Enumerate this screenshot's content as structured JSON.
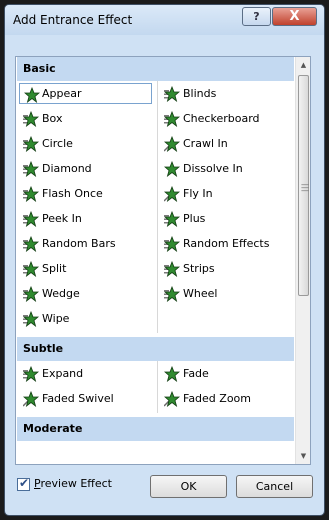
{
  "window": {
    "title": "Add Entrance Effect",
    "help_glyph": "?",
    "close_glyph": "X"
  },
  "sections": [
    {
      "label": "Basic",
      "items": [
        {
          "label": "Appear",
          "icon": "appear-star-icon",
          "selected": true
        },
        {
          "label": "Blinds",
          "icon": "blinds-star-icon"
        },
        {
          "label": "Box",
          "icon": "box-star-icon"
        },
        {
          "label": "Checkerboard",
          "icon": "checkerboard-star-icon"
        },
        {
          "label": "Circle",
          "icon": "circle-star-icon"
        },
        {
          "label": "Crawl In",
          "icon": "crawl-in-star-icon"
        },
        {
          "label": "Diamond",
          "icon": "diamond-star-icon"
        },
        {
          "label": "Dissolve In",
          "icon": "dissolve-in-star-icon"
        },
        {
          "label": "Flash Once",
          "icon": "flash-once-star-icon"
        },
        {
          "label": "Fly In",
          "icon": "fly-in-star-icon"
        },
        {
          "label": "Peek In",
          "icon": "peek-in-star-icon"
        },
        {
          "label": "Plus",
          "icon": "plus-star-icon"
        },
        {
          "label": "Random Bars",
          "icon": "random-bars-star-icon"
        },
        {
          "label": "Random Effects",
          "icon": "random-effects-star-icon"
        },
        {
          "label": "Split",
          "icon": "split-star-icon"
        },
        {
          "label": "Strips",
          "icon": "strips-star-icon"
        },
        {
          "label": "Wedge",
          "icon": "wedge-star-icon"
        },
        {
          "label": "Wheel",
          "icon": "wheel-star-icon"
        },
        {
          "label": "Wipe",
          "icon": "wipe-star-icon"
        }
      ]
    },
    {
      "label": "Subtle",
      "items": [
        {
          "label": "Expand",
          "icon": "expand-star-icon"
        },
        {
          "label": "Fade",
          "icon": "fade-star-icon"
        },
        {
          "label": "Faded Swivel",
          "icon": "faded-swivel-star-icon"
        },
        {
          "label": "Faded Zoom",
          "icon": "faded-zoom-star-icon"
        }
      ]
    },
    {
      "label": "Moderate",
      "items": []
    }
  ],
  "footer": {
    "preview_checked": true,
    "preview_label_mnemonic": "P",
    "preview_label_rest": "review Effect",
    "ok_label": "OK",
    "cancel_label": "Cancel"
  },
  "colors": {
    "section_header": "#c3d9f1",
    "dialog_bg": "#cfe1f4",
    "star_green": "#2f8a2f"
  }
}
